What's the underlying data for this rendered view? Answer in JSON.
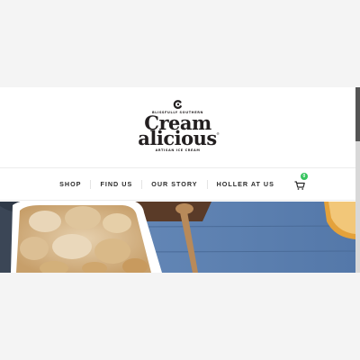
{
  "brand": {
    "tagline_top": "BLISSFULLY SOUTHERN",
    "line1": "Cream",
    "line2": "alicious",
    "trademark": "®",
    "tagline_bottom": "ARTISAN ICE CREAM"
  },
  "nav": {
    "items": [
      {
        "label": "SHOP"
      },
      {
        "label": "FIND US"
      },
      {
        "label": "OUR STORY"
      },
      {
        "label": "HOLLER AT US"
      }
    ],
    "cart_count": "0"
  },
  "colors": {
    "logo": "#231f20",
    "badge": "#36c45e",
    "table": "#5d86b9"
  },
  "icons": {
    "logo_mark": "cream-swirl-icon",
    "cart": "shopping-cart-icon"
  }
}
